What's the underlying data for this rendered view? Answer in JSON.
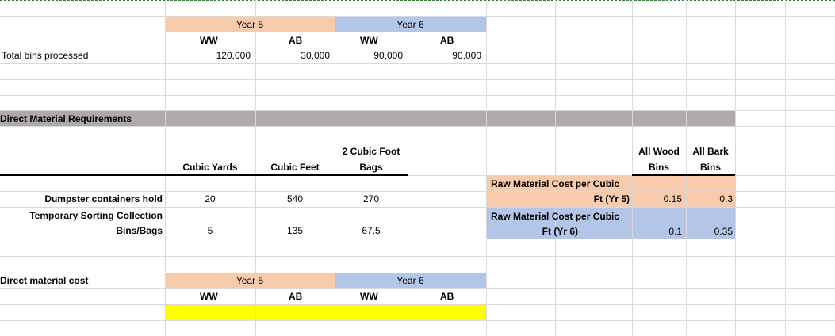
{
  "colors": {
    "year5": "#f8cbad",
    "year6": "#b4c6e7",
    "section": "#aeaaaa",
    "highlight": "#ffff00",
    "grid": "#d9d9d9"
  },
  "bins": {
    "year5_label": "Year 5",
    "year6_label": "Year 6",
    "ww": "WW",
    "ab": "AB",
    "row_label": "Total bins processed",
    "values": [
      "120,000",
      "30,000",
      "90,000",
      "90,000"
    ]
  },
  "dm": {
    "section_title": "Direct Material Requirements",
    "headers": {
      "cubic_yards": "Cubic Yards",
      "cubic_feet": "Cubic Feet",
      "bags_line1": "2 Cubic Foot",
      "bags_line2": "Bags"
    },
    "row1": {
      "label": "Dumpster containers hold",
      "values": [
        "20",
        "540",
        "270"
      ]
    },
    "row2": {
      "label_line1": "Temporary Sorting Collection",
      "label_line2": "Bins/Bags",
      "values": [
        "5",
        "135",
        "67.5"
      ]
    }
  },
  "cost_table": {
    "header_wood_line1": "All Wood",
    "header_wood_line2": "Bins",
    "header_bark_line1": "All Bark",
    "header_bark_line2": "Bins",
    "row_y5": {
      "label_line1": "Raw Material Cost per Cubic",
      "label_line2": "Ft (Yr 5)",
      "wood": "0.15",
      "bark": "0.3"
    },
    "row_y6": {
      "label_line1": "Raw Material Cost per Cubic",
      "label_line2": "Ft (Yr 6)",
      "wood": "0.1",
      "bark": "0.35"
    }
  },
  "dmc": {
    "label": "Direct material cost",
    "year5_label": "Year 5",
    "year6_label": "Year 6",
    "ww": "WW",
    "ab": "AB"
  }
}
